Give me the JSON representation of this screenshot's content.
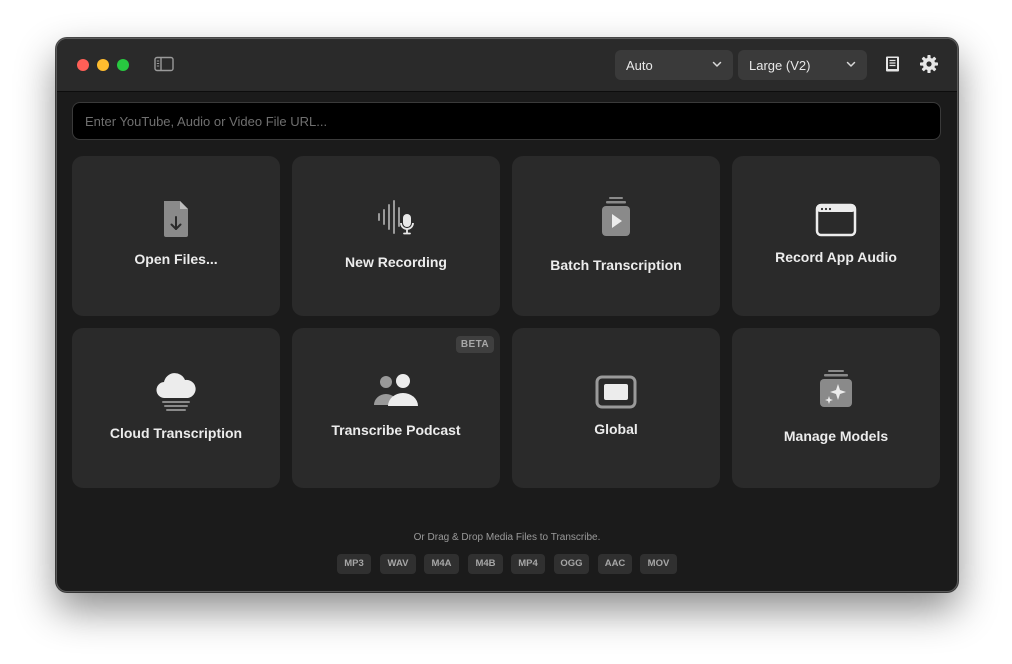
{
  "toolbar": {
    "language_dropdown": "Auto",
    "model_dropdown": "Large (V2)",
    "dropdown_chevron": "⌄"
  },
  "url_input": {
    "placeholder": "Enter YouTube, Audio or Video File URL...",
    "value": ""
  },
  "cards": [
    {
      "label": "Open Files...",
      "icon": "document-download-icon"
    },
    {
      "label": "New Recording",
      "icon": "waveform-mic-icon"
    },
    {
      "label": "Batch Transcription",
      "icon": "stacked-play-icon"
    },
    {
      "label": "Record App Audio",
      "icon": "app-window-icon"
    },
    {
      "label": "Cloud Transcription",
      "icon": "cloud-icon"
    },
    {
      "label": "Transcribe Podcast",
      "icon": "people-icon",
      "badge": "BETA"
    },
    {
      "label": "Global",
      "icon": "display-icon"
    },
    {
      "label": "Manage Models",
      "icon": "sparkles-stack-icon"
    }
  ],
  "hint": "Or Drag & Drop Media Files to Transcribe.",
  "formats": [
    "MP3",
    "WAV",
    "M4A",
    "M4B",
    "MP4",
    "OGG",
    "AAC",
    "MOV"
  ],
  "colors": {
    "window_bg": "#1b1b1b",
    "card_bg": "#2a2a2a",
    "traffic_red": "#fe5f57",
    "traffic_yellow": "#febc2e",
    "traffic_green": "#28c840"
  }
}
